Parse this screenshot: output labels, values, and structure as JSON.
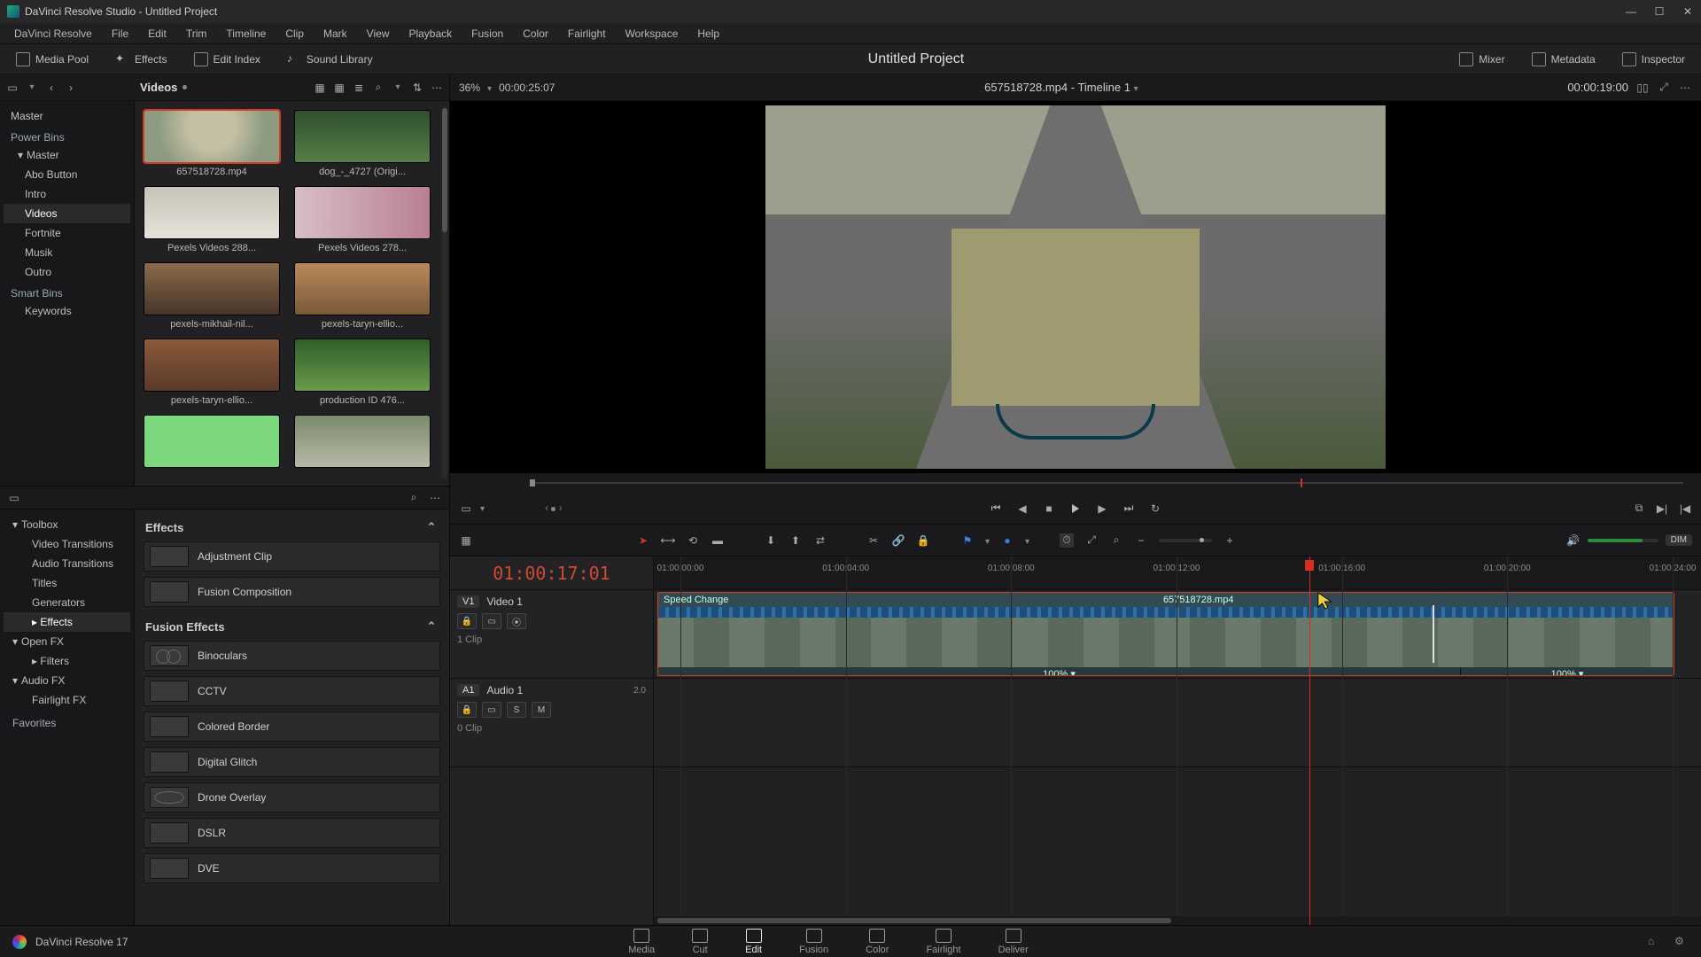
{
  "window": {
    "title": "DaVinci Resolve Studio - Untitled Project"
  },
  "menubar": [
    "DaVinci Resolve",
    "File",
    "Edit",
    "Trim",
    "Timeline",
    "Clip",
    "Mark",
    "View",
    "Playback",
    "Fusion",
    "Color",
    "Fairlight",
    "Workspace",
    "Help"
  ],
  "toolbar": {
    "media_pool": "Media Pool",
    "effects": "Effects",
    "edit_index": "Edit Index",
    "sound_library": "Sound Library",
    "project_title": "Untitled Project",
    "mixer": "Mixer",
    "metadata": "Metadata",
    "inspector": "Inspector"
  },
  "mediapool": {
    "bin_name": "Videos",
    "zoom": "36%",
    "duration": "00:00:25:07",
    "timeline_label": "657518728.mp4 - Timeline 1",
    "right_timecode": "00:00:19:00",
    "bins": {
      "root": "Master",
      "power_bins": "Power Bins",
      "power_master": "Master",
      "power_children": [
        "Abo Button",
        "Intro",
        "Videos",
        "Fortnite",
        "Musik",
        "Outro"
      ],
      "smart_bins": "Smart Bins",
      "smart_children": [
        "Keywords"
      ]
    },
    "clips": [
      {
        "name": "657518728.mp4",
        "thumb": "th-bike",
        "selected": true
      },
      {
        "name": "dog_-_4727 (Origi...",
        "thumb": "th-dog"
      },
      {
        "name": "Pexels Videos 288...",
        "thumb": "th-mist"
      },
      {
        "name": "Pexels Videos 278...",
        "thumb": "th-pink"
      },
      {
        "name": "pexels-mikhail-nil...",
        "thumb": "th-forest1"
      },
      {
        "name": "pexels-taryn-ellio...",
        "thumb": "th-forest2"
      },
      {
        "name": "pexels-taryn-ellio...",
        "thumb": "th-forest3"
      },
      {
        "name": "production ID 476...",
        "thumb": "th-green"
      },
      {
        "name": "",
        "thumb": "th-rabbit"
      },
      {
        "name": "",
        "thumb": "th-man"
      }
    ]
  },
  "fx": {
    "tree": {
      "toolbox": "Toolbox",
      "toolbox_children": [
        "Video Transitions",
        "Audio Transitions",
        "Titles",
        "Generators",
        "Effects"
      ],
      "openfx": "Open FX",
      "openfx_children": [
        "Filters"
      ],
      "audiofx": "Audio FX",
      "audiofx_children": [
        "Fairlight FX"
      ],
      "favorites": "Favorites"
    },
    "sections": {
      "effects_hdr": "Effects",
      "fusion_hdr": "Fusion Effects"
    },
    "effects_list": [
      "Adjustment Clip",
      "Fusion Composition"
    ],
    "fusion_list": [
      "Binoculars",
      "CCTV",
      "Colored Border",
      "Digital Glitch",
      "Drone Overlay",
      "DSLR",
      "DVE"
    ]
  },
  "timeline": {
    "playhead_tc": "01:00:17:01",
    "ruler": [
      "01:00:00:00",
      "01:00:04:00",
      "01:00:08:00",
      "01:00:12:00",
      "01:00:16:00",
      "01:00:20:00",
      "01:00:24:00"
    ],
    "video_track": {
      "badge": "V1",
      "name": "Video 1",
      "subtitle": "1 Clip"
    },
    "audio_track": {
      "badge": "A1",
      "name": "Audio 1",
      "level": "2.0",
      "subtitle": "0 Clip",
      "solo": "S",
      "mute": "M"
    },
    "clip": {
      "label": "Speed Change",
      "name": "657518728.mp4",
      "speed_left": "100%",
      "speed_right": "100%"
    },
    "dim": "DIM"
  },
  "pages": [
    "Media",
    "Cut",
    "Edit",
    "Fusion",
    "Color",
    "Fairlight",
    "Deliver"
  ],
  "footer_label": "DaVinci Resolve 17"
}
